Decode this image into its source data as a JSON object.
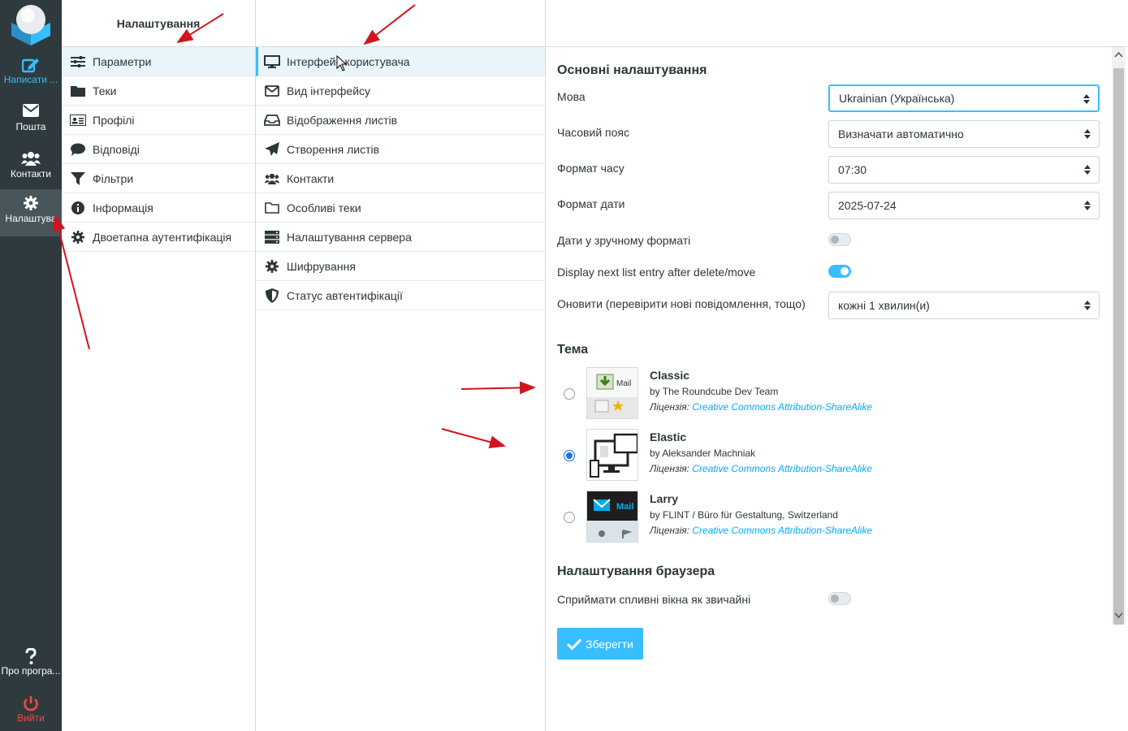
{
  "nav": {
    "compose": "Написати ...",
    "mail": "Пошта",
    "contacts": "Контакти",
    "settings": "Налаштува",
    "about": "Про програ...",
    "logout": "Вийти"
  },
  "sections": {
    "header": "Налаштування",
    "items": [
      {
        "label": "Параметри",
        "icon": "sliders-icon"
      },
      {
        "label": "Теки",
        "icon": "folder-icon"
      },
      {
        "label": "Профілі",
        "icon": "id-card-icon"
      },
      {
        "label": "Відповіді",
        "icon": "comment-icon"
      },
      {
        "label": "Фільтри",
        "icon": "filter-icon"
      },
      {
        "label": "Інформація",
        "icon": "info-icon"
      },
      {
        "label": "Двоетапна аутентифікація",
        "icon": "gear-icon"
      }
    ]
  },
  "prefs": {
    "items": [
      {
        "label": "Інтерфейс користувача",
        "icon": "monitor-icon"
      },
      {
        "label": "Вид інтерфейсу",
        "icon": "envelope-icon"
      },
      {
        "label": "Відображення листів",
        "icon": "inbox-icon"
      },
      {
        "label": "Створення листів",
        "icon": "paper-plane-icon"
      },
      {
        "label": "Контакти",
        "icon": "users-icon"
      },
      {
        "label": "Особливі теки",
        "icon": "folder-open-icon"
      },
      {
        "label": "Налаштування сервера",
        "icon": "server-icon"
      },
      {
        "label": "Шифрування",
        "icon": "gear-icon"
      },
      {
        "label": "Статус автентифікації",
        "icon": "shield-icon"
      }
    ]
  },
  "main": {
    "section_title": "Основні налаштування",
    "language_label": "Мова",
    "language_value": "Ukrainian (Українська)",
    "timezone_label": "Часовий пояс",
    "timezone_value": "Визначати автоматично",
    "timeformat_label": "Формат часу",
    "timeformat_value": "07:30",
    "dateformat_label": "Формат дати",
    "dateformat_value": "2025-07-24",
    "prettydate_label": "Дати у зручному форматі",
    "prettydate_on": false,
    "nextentry_label": "Display next list entry after delete/move",
    "nextentry_on": true,
    "refresh_label": "Оновити (перевірити нові повідомлення, тощо)",
    "refresh_value": "кожні 1 хвилин(и)",
    "theme_title": "Тема",
    "themes": [
      {
        "name": "Classic",
        "author": "by The Roundcube Dev Team",
        "license_prefix": "Ліцензія:",
        "license": "Creative Commons Attribution-ShareAlike",
        "selected": false,
        "thumb_text": "Mail"
      },
      {
        "name": "Elastic",
        "author": "by Aleksander Machniak",
        "license_prefix": "Ліцензія:",
        "license": "Creative Commons Attribution-ShareAlike",
        "selected": true
      },
      {
        "name": "Larry",
        "author": "by FLINT / Büro für Gestaltung, Switzerland",
        "license_prefix": "Ліцензія:",
        "license": "Creative Commons Attribution-ShareAlike",
        "selected": false,
        "thumb_text": "Mail"
      }
    ],
    "browser_title": "Налаштування браузера",
    "popups_label": "Сприймати спливні вікна як звичайні",
    "popups_on": false,
    "save_label": "Зберегти"
  },
  "colors": {
    "accent": "#37beff",
    "nav_bg": "#2f3a3f",
    "annotation": "#d0141c"
  }
}
